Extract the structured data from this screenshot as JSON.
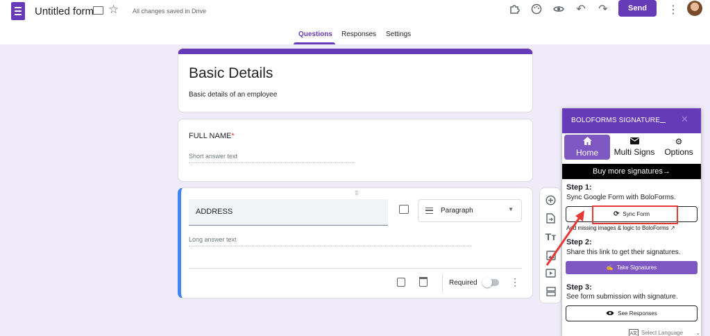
{
  "header": {
    "form_title": "Untitled form",
    "save_status": "All changes saved in Drive",
    "send_label": "Send"
  },
  "tabs": [
    {
      "label": "Questions",
      "active": true
    },
    {
      "label": "Responses",
      "active": false
    },
    {
      "label": "Settings",
      "active": false
    }
  ],
  "form": {
    "title": "Basic Details",
    "description": "Basic details of an employee",
    "questions": [
      {
        "title": "FULL NAME",
        "required_marker": "*",
        "answer_placeholder": "Short answer text"
      },
      {
        "title": "ADDRESS",
        "type": "Paragraph",
        "answer_placeholder": "Long answer text",
        "required_label": "Required"
      }
    ]
  },
  "boloforms": {
    "title": "BOLOFORMS SIGNATURE",
    "minimize": "_",
    "close": "✕",
    "tabs": [
      {
        "label": "Home",
        "icon": "home-icon",
        "active": true
      },
      {
        "label": "Multi Signs",
        "icon": "mail-icon",
        "active": false
      },
      {
        "label": "Options",
        "icon": "gear-icon",
        "active": false
      }
    ],
    "buy_banner": "Buy more signatures→",
    "step1_title": "Step 1:",
    "step1_desc": "Sync Google Form with BoloForms.",
    "sync_button": "Sync Form",
    "step1_hint": "Add missing images & logic to BoloForms",
    "step2_title": "Step 2:",
    "step2_desc": "Share this link to get their signatures.",
    "take_signatures_button": "Take Signatures",
    "step3_title": "Step 3:",
    "step3_desc": "See form submission with signature.",
    "see_responses_button": "See Responses",
    "language_select": "Select Language"
  },
  "colors": {
    "accent": "#673ab7",
    "background": "#f0ebf8",
    "highlight": "#e53935",
    "active_question": "#4285f4"
  }
}
